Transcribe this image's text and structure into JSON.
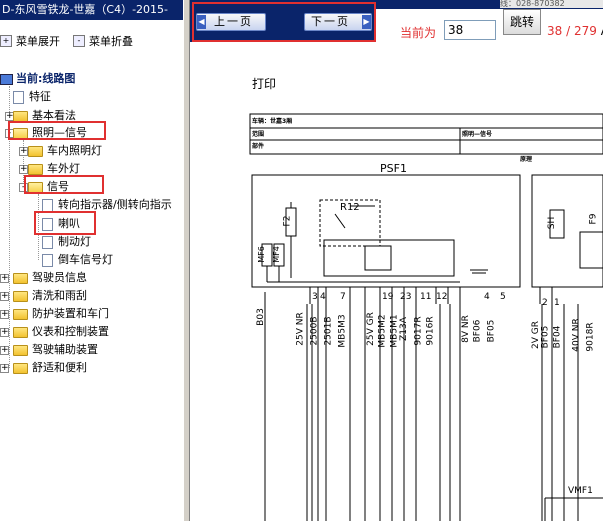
{
  "window": {
    "title": "D-东风雪铁龙-世嘉（C4）-2015-"
  },
  "menu": {
    "expand": "菜单展开",
    "collapse": "菜单折叠"
  },
  "tree": {
    "root": "当前:线路图",
    "items": [
      {
        "label": "特征"
      },
      {
        "label": "基本看法"
      },
      {
        "label": "照明—信号"
      },
      {
        "label": "车内照明灯"
      },
      {
        "label": "车外灯"
      },
      {
        "label": "信号"
      },
      {
        "label": "转向指示器/侧转向指示"
      },
      {
        "label": "喇叭"
      },
      {
        "label": "制动灯"
      },
      {
        "label": "倒车信号灯"
      },
      {
        "label": "驾驶员信息"
      },
      {
        "label": "清洗和雨刮"
      },
      {
        "label": "防护装置和车门"
      },
      {
        "label": "仪表和控制装置"
      },
      {
        "label": "驾驶辅助装置"
      },
      {
        "label": "舒适和便利"
      }
    ]
  },
  "viewer": {
    "prev": "上一页",
    "next": "下一页",
    "current_label": "当前为",
    "current_page": "38",
    "go": "跳转",
    "page_count": "38 / 279",
    "page_count_suffix": "A",
    "top_right_fragment": "线：028-870382"
  },
  "document": {
    "print": "打印",
    "header": {
      "vehicle": "车辆：世嘉3厢",
      "scope": "范围",
      "system": "照明—信号",
      "component": "部件",
      "type": "原理"
    },
    "boxes": {
      "psf1": "PSF1",
      "r12": "R12",
      "f2": "F2",
      "mf6": "MF6",
      "mf4": "MF4",
      "f9": "F9",
      "sh": "SH",
      "vmf1": "VMF1"
    },
    "pins": [
      "3",
      "4",
      "7",
      "19",
      "23",
      "11",
      "12",
      "4",
      "5",
      "2",
      "1"
    ],
    "wires": [
      "B03",
      "25V",
      "NR",
      "2500B",
      "2501B",
      "MB5M3",
      "25V",
      "GR",
      "MB5M2",
      "MB5M1",
      "Z13A",
      "9017R",
      "9016R",
      "8V",
      "NR",
      "BF06",
      "BF05",
      "2V",
      "GR",
      "BF05",
      "BF04",
      "40V",
      "NR",
      "9018R"
    ]
  },
  "colors": {
    "titlebar": "#0a246a",
    "highlight": "#e03030",
    "pagecount": "#e03030"
  }
}
